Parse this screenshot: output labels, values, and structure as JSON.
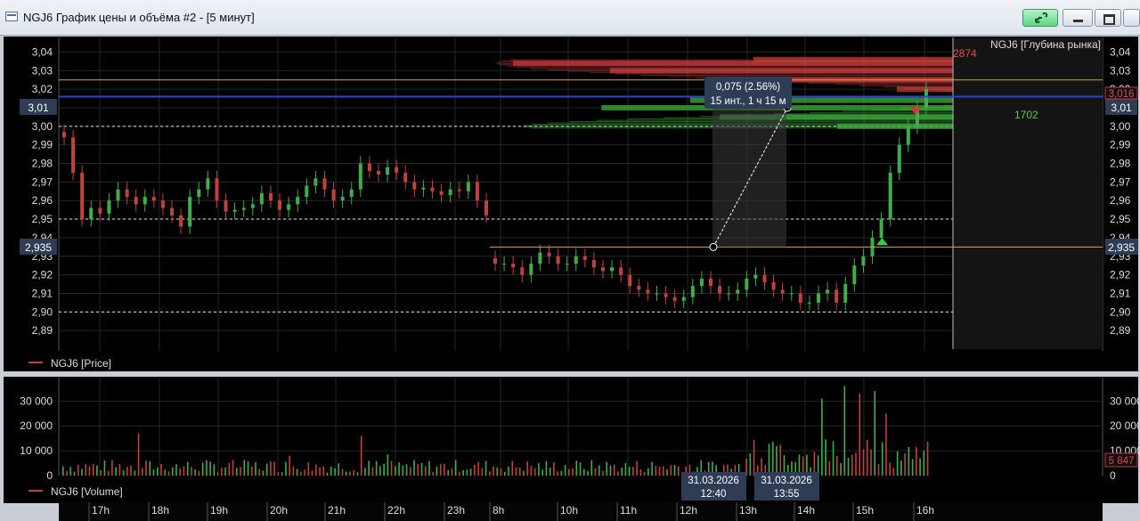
{
  "window": {
    "title": "NGJ6 График цены и объёма #2 - [5 минут]",
    "icons": [
      "chart-window-icon",
      "link-icon",
      "minimize-icon",
      "maximize-icon",
      "close-icon"
    ]
  },
  "colors": {
    "background": "#000000",
    "bull": "#3fae4a",
    "bear": "#c0413e",
    "ask_depth": "#c43c3c",
    "bid_depth": "#3cae3c",
    "ruler": "#ffffff",
    "level_line": "#e0a040",
    "blue_line": "#3040d0",
    "label_bg": "#2e3d55"
  },
  "depth_panel": {
    "title": "NGJ6 [Глубина рынка]",
    "ask_max_label": "2874",
    "bid_max_label": "1702",
    "best_ask_tag": "3,016"
  },
  "ruler": {
    "line1": "0,075 (2.56%)",
    "line2": "15 инт., 1 ч 15 м"
  },
  "price_tags": {
    "cursor_left": "3,01",
    "cursor_right": "3,01",
    "level_left": "2,935",
    "level_right": "2,935"
  },
  "volume_tag": "5 847",
  "time_tags": [
    {
      "date": "31.03.2026",
      "time": "12:40"
    },
    {
      "date": "31.03.2026",
      "time": "13:55"
    }
  ],
  "legend": {
    "price": "NGJ6 [Price]",
    "volume": "NGJ6 [Volume]"
  },
  "chart_data": [
    {
      "type": "candlestick",
      "series": [
        {
          "name": "NGJ6 [Price]"
        }
      ],
      "ylim": [
        2.88,
        3.045
      ],
      "y_ticks": [
        "2,89",
        "2,90",
        "2,91",
        "2,92",
        "2,93",
        "2,94",
        "2,95",
        "2,96",
        "2,97",
        "2,98",
        "2,99",
        "3,00",
        "3,01",
        "3,02",
        "3,03",
        "3,04"
      ],
      "x_ticks": [
        "17h",
        "18h",
        "19h",
        "20h",
        "21h",
        "22h",
        "23h",
        "8h",
        "10h",
        "11h",
        "12h",
        "13h",
        "14h",
        "15h",
        "16h"
      ],
      "dashed_levels": [
        3.0,
        2.95,
        2.9
      ],
      "level_lines": [
        2.935,
        3.025
      ],
      "blue_line": 3.016,
      "segments": [
        {
          "start_hour": 16.5,
          "bars": [
            2.994,
            2.975,
            2.95,
            2.956,
            2.953,
            2.96,
            2.966,
            2.962,
            2.958,
            2.962,
            2.96,
            2.956,
            2.952,
            2.946,
            2.962,
            2.966,
            2.972,
            2.96,
            2.954,
            2.955,
            2.956,
            2.958,
            2.964,
            2.96,
            2.955,
            2.958,
            2.962,
            2.968,
            2.972,
            2.966,
            2.96,
            2.962,
            2.966,
            2.98,
            2.976,
            2.974,
            2.978,
            2.975,
            2.97,
            2.966,
            2.967,
            2.965,
            2.963,
            2.966,
            2.965,
            2.97,
            2.96,
            2.952
          ]
        },
        {
          "start_hour": 8.0,
          "bars": [
            2.926,
            2.926,
            2.924,
            2.92,
            2.926,
            2.932,
            2.93,
            2.926,
            2.926,
            2.93,
            2.928,
            2.924,
            2.922,
            2.924,
            2.92,
            2.914,
            2.912,
            2.91,
            2.91,
            2.908,
            2.906,
            2.908,
            2.914,
            2.918,
            2.914,
            2.91,
            2.91,
            2.912,
            2.918,
            2.92,
            2.916,
            2.912,
            2.91,
            2.91,
            2.905,
            2.905,
            2.91,
            2.912,
            2.905,
            2.915,
            2.925,
            2.93,
            2.94,
            2.95,
            2.975,
            2.99,
            3.0,
            3.01,
            3.02
          ]
        }
      ]
    },
    {
      "type": "bar",
      "series": [
        {
          "name": "NGJ6 [Volume]"
        }
      ],
      "ylim": [
        0,
        38000
      ],
      "y_ticks": [
        "10 000",
        "20 000",
        "30 000"
      ],
      "left_zero_label": "0",
      "right_zero_label": "0",
      "seed": 7,
      "spikes": [
        {
          "bar": 20,
          "value": 17000
        },
        {
          "bar": 60,
          "value": 8000
        },
        {
          "bar": 79,
          "value": 16000
        },
        {
          "bar": 86,
          "value": 8500
        },
        {
          "bar": 201,
          "value": 31000
        },
        {
          "bar": 207,
          "value": 36000
        },
        {
          "bar": 211,
          "value": 33000
        },
        {
          "bar": 215,
          "value": 34000
        },
        {
          "bar": 218,
          "value": 25000
        }
      ]
    },
    {
      "type": "area",
      "series": [
        {
          "name": "NGJ6 [Глубина рынка]"
        }
      ],
      "ask_profile": [
        [
          3.016,
          400
        ],
        [
          3.02,
          1000
        ],
        [
          3.025,
          1900
        ],
        [
          3.03,
          2400
        ],
        [
          3.034,
          2874
        ],
        [
          3.036,
          1700
        ]
      ],
      "bid_profile": [
        [
          3.0,
          900
        ],
        [
          3.005,
          1300
        ],
        [
          3.01,
          1702
        ],
        [
          3.014,
          1400
        ]
      ]
    }
  ]
}
